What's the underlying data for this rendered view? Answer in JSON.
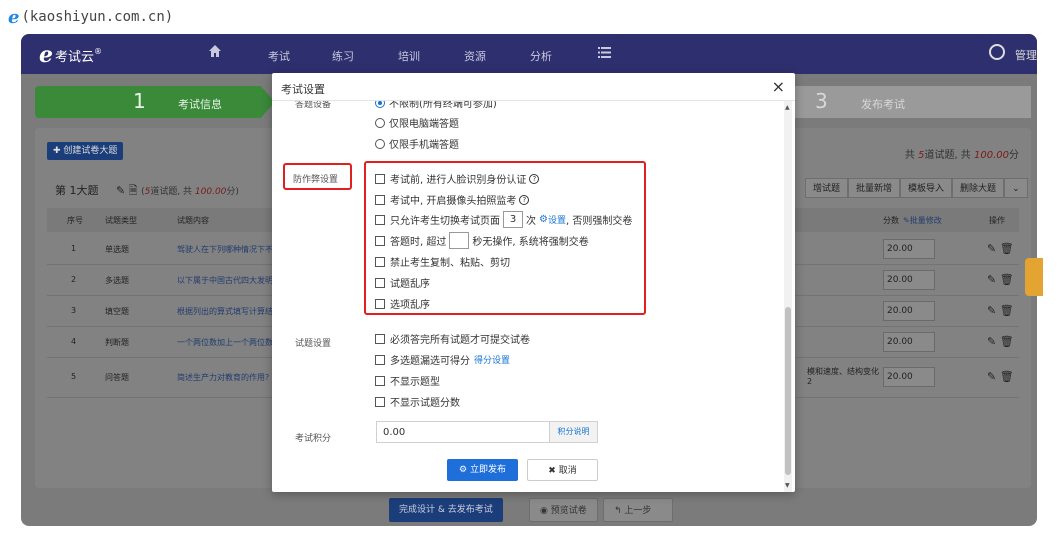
{
  "url_bar": {
    "text": "(kaoshiyun.com.cn)"
  },
  "topnav": {
    "brand": "考试云",
    "brand_mark": "®",
    "items": [
      "考试",
      "练习",
      "培训",
      "资源",
      "分析"
    ],
    "user_label": "管理"
  },
  "steps": [
    {
      "num": "1",
      "label": "考试信息"
    },
    {
      "num": "3",
      "label": "发布考试"
    }
  ],
  "content": {
    "create_button": "创建试卷大题",
    "total_prefix": "共 ",
    "total_count": "5",
    "total_mid": "道试题, 共 ",
    "total_score": "100.00",
    "total_suffix": "分",
    "section_title": "第 1大题",
    "section_sub_prefix": "(",
    "section_count": "5",
    "section_sub_mid": "道试题, 共 ",
    "section_score": "100.00",
    "section_sub_suffix": "分)",
    "right_buttons": [
      "增试题",
      "批量新增",
      "模板导入",
      "删除大题"
    ],
    "headers": [
      "序号",
      "试题类型",
      "试题内容",
      "分数",
      "批量修改",
      "操作"
    ],
    "rows": [
      {
        "no": "1",
        "type": "单选题",
        "content": "驾驶人在下列哪种情况下不能",
        "score": "20.00",
        "extra": ""
      },
      {
        "no": "2",
        "type": "多选题",
        "content": "以下属于中国古代四大发明的",
        "score": "20.00",
        "extra": ""
      },
      {
        "no": "3",
        "type": "填空题",
        "content": "根据列出的算式填写计算结果",
        "score": "20.00",
        "extra": ""
      },
      {
        "no": "4",
        "type": "判断题",
        "content": "一个两位数加上一个两位数,",
        "score": "20.00",
        "extra": ""
      },
      {
        "no": "5",
        "type": "问答题",
        "content": "简述生产力对教育的作用?",
        "score": "20.00",
        "extra": "模和速度、结构变化 2"
      }
    ]
  },
  "bottom": {
    "finish": "完成设计 & 去发布考试",
    "preview": "预览试卷",
    "prev": "上一步"
  },
  "modal": {
    "title": "考试设置",
    "close": "×",
    "answer_device_label": "答题设备",
    "answer_device_cut": "不限制(所有终端可参加)",
    "device_options": [
      "仅限电脑端答题",
      "仅限手机端答题"
    ],
    "anti_cheat_label": "防作弊设置",
    "anti_cheat": {
      "face": "考试前, 进行人脸识别身份认证",
      "camera": "考试中, 开启摄像头拍照监考",
      "switch_prefix": "只允许考生切换考试页面",
      "switch_value": "3",
      "switch_mid": "次",
      "switch_link": "设置",
      "switch_suffix": ", 否则强制交卷",
      "idle_prefix": "答题时, 超过",
      "idle_suffix": "秒无操作, 系统将强制交卷",
      "no_copy": "禁止考生复制、粘贴、剪切",
      "shuffle_q": "试题乱序",
      "shuffle_opt": "选项乱序"
    },
    "paper_settings_label": "试题设置",
    "paper_settings": {
      "must_finish": "必须答完所有试题才可提交试卷",
      "multi_partial": "多选题漏选可得分",
      "multi_link": "得分设置",
      "hide_type": "不显示题型",
      "hide_score": "不显示试题分数"
    },
    "exam_points_label": "考试积分",
    "exam_points_value": "0.00",
    "exam_points_help": "积分说明",
    "publish": "立即发布",
    "cancel": "取消"
  },
  "colors": {
    "highlight": "#e02020",
    "primary": "#1e6fd9",
    "nav": "#2e2f6e"
  }
}
